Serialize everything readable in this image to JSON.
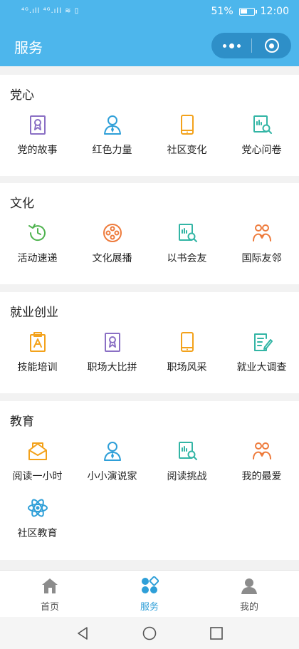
{
  "status": {
    "signal": "⁴ᴳ.ıll ⁴ᴳ.ıll ≋ ▯",
    "battery_pct": "51%",
    "time": "12:00"
  },
  "header": {
    "title": "服务"
  },
  "sections": [
    {
      "title": "党心",
      "items": [
        {
          "label": "党的故事",
          "icon": "certificate-icon",
          "color": "#8a6fc4"
        },
        {
          "label": "红色力量",
          "icon": "person-tie-icon",
          "color": "#2e9fd8"
        },
        {
          "label": "社区变化",
          "icon": "tablet-icon",
          "color": "#f3a21b"
        },
        {
          "label": "党心问卷",
          "icon": "book-search-icon",
          "color": "#33b5a5"
        }
      ]
    },
    {
      "title": "文化",
      "items": [
        {
          "label": "活动速递",
          "icon": "clock-refresh-icon",
          "color": "#4fb34f"
        },
        {
          "label": "文化展播",
          "icon": "film-reel-icon",
          "color": "#ee7b3c"
        },
        {
          "label": "以书会友",
          "icon": "book-search-icon",
          "color": "#33b5a5"
        },
        {
          "label": "国际友邻",
          "icon": "friends-icon",
          "color": "#ee7b3c"
        }
      ]
    },
    {
      "title": "就业创业",
      "items": [
        {
          "label": "技能培训",
          "icon": "clipboard-icon",
          "color": "#f3a21b"
        },
        {
          "label": "职场大比拼",
          "icon": "certificate-icon",
          "color": "#8a6fc4"
        },
        {
          "label": "职场风采",
          "icon": "tablet-icon",
          "color": "#f3a21b"
        },
        {
          "label": "就业大调查",
          "icon": "document-pen-icon",
          "color": "#33b5a5"
        }
      ]
    },
    {
      "title": "教育",
      "items": [
        {
          "label": "阅读一小时",
          "icon": "envelope-icon",
          "color": "#f3a21b"
        },
        {
          "label": "小小演说家",
          "icon": "person-tie-icon",
          "color": "#2e9fd8"
        },
        {
          "label": "阅读挑战",
          "icon": "book-search-icon",
          "color": "#33b5a5"
        },
        {
          "label": "我的最爱",
          "icon": "friends-icon",
          "color": "#ee7b3c"
        },
        {
          "label": "社区教育",
          "icon": "atom-icon",
          "color": "#2e9fd8"
        }
      ]
    }
  ],
  "tabbar": [
    {
      "label": "首页",
      "icon": "home-icon",
      "active": false
    },
    {
      "label": "服务",
      "icon": "service-icon",
      "active": true
    },
    {
      "label": "我的",
      "icon": "profile-icon",
      "active": false
    }
  ],
  "colors": {
    "primary": "#4db6ec",
    "capsule": "#2e8fc8",
    "active_tab": "#2e9fd8"
  }
}
